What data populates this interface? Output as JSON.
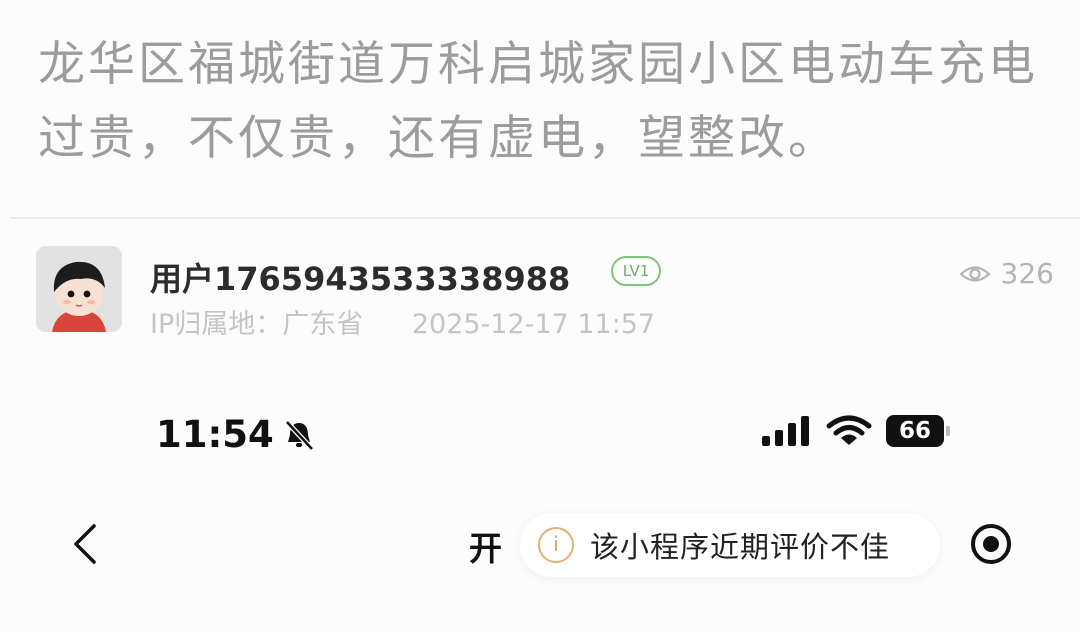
{
  "post": {
    "text": "龙华区福城街道万科启城家园小区电动车充电过贵，不仅贵，还有虚电，望整改。"
  },
  "author": {
    "username": "用户1765943533338988",
    "level": "LV1",
    "ip_location": "IP归属地：广东省",
    "datetime": "2025-12-17 11:57",
    "views": "326"
  },
  "embedded_screenshot": {
    "status_bar": {
      "time": "11:54",
      "battery": "66"
    },
    "nav": {
      "title_fragment": "开",
      "warning_text": "该小程序近期评价不佳"
    }
  },
  "icons": {
    "view": "eye-icon",
    "mute": "bell-slash-icon",
    "signal": "signal-icon",
    "wifi": "wifi-icon",
    "battery": "battery-icon",
    "back": "chevron-left-icon",
    "info": "info-icon",
    "record": "record-icon"
  },
  "colors": {
    "level_badge": "#7ec47a",
    "warning_icon": "#e4b071",
    "muted_text": "#9c9c9c"
  }
}
